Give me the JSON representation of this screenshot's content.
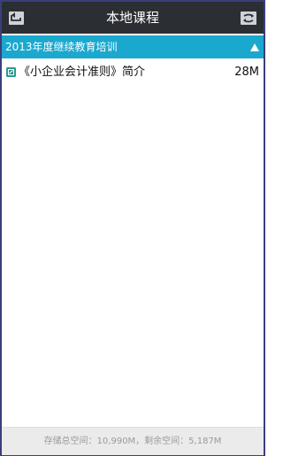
{
  "header": {
    "title": "本地课程",
    "back_icon": "back-icon",
    "refresh_icon": "refresh-icon"
  },
  "group": {
    "label": "2013年度继续教育培训",
    "expanded": true,
    "caret_icon": "collapse-caret-icon"
  },
  "courses": [
    {
      "name": "《小企业会计准则》简介",
      "size": "28M",
      "icon": "course-file-icon"
    }
  ],
  "footer": {
    "storage_text": "存储总空间：10,990M，剩余空间：5,187M"
  },
  "colors": {
    "topbar": "#2b2e33",
    "accent": "#1ba8cf",
    "footer_bg": "#ebebeb",
    "frame_border": "#3a3f7a"
  }
}
